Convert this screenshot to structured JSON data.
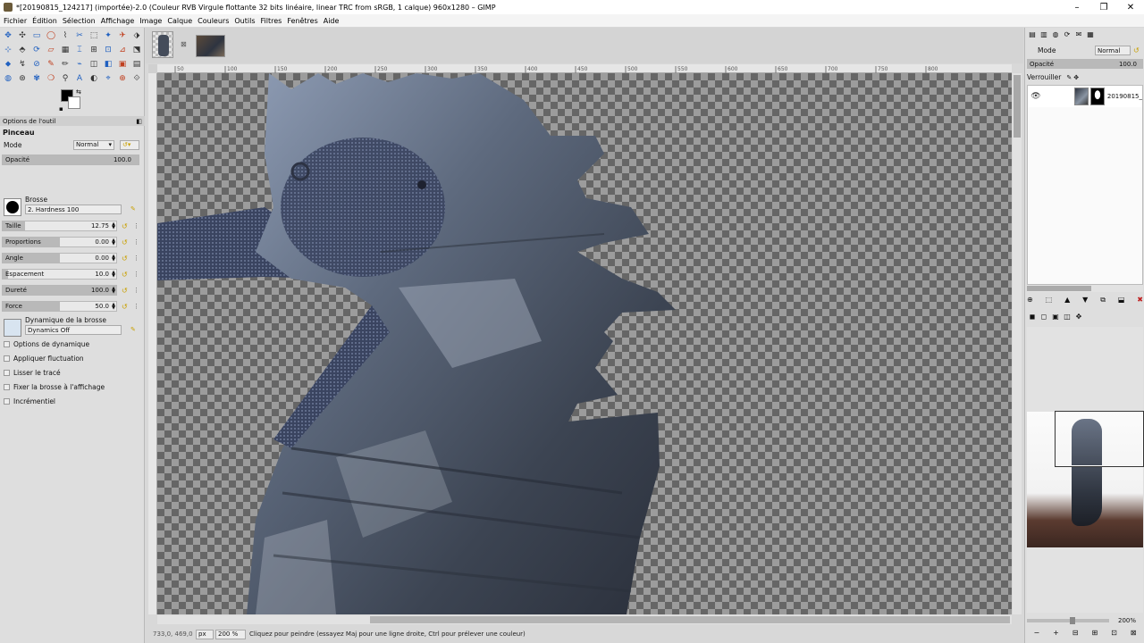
{
  "window": {
    "title": "*[20190815_124217] (importée)-2.0 (Couleur RVB Virgule flottante 32 bits linéaire, linear TRC from sRGB, 1 calque) 960x1280 – GIMP",
    "minimize": "–",
    "maximize": "❐",
    "close": "✕"
  },
  "menu": [
    "Fichier",
    "Édition",
    "Sélection",
    "Affichage",
    "Image",
    "Calque",
    "Couleurs",
    "Outils",
    "Filtres",
    "Fenêtres",
    "Aide"
  ],
  "toolbox": {
    "tools": [
      "✥",
      "✣",
      "▭",
      "◯",
      "⌇",
      "✂",
      "⬚",
      "✦",
      "✈",
      "⬗",
      "⊹",
      "⬘",
      "⟳",
      "▱",
      "▦",
      "⌶",
      "⊞",
      "⊡",
      "⊿",
      "⬔",
      "⬥",
      "↯",
      "⊘",
      "✎",
      "✏",
      "⌁",
      "◫",
      "◧",
      "▣",
      "▤",
      "◍",
      "⊛",
      "✾",
      "❍",
      "⚲",
      "A",
      "◐",
      "⌖",
      "⊕",
      "⟐"
    ],
    "colors_mini": "▪",
    "colors_swap": "⇆"
  },
  "tool_options": {
    "header": "Options de l'outil",
    "header_icon": "◧",
    "title": "Pinceau",
    "mode_label": "Mode",
    "mode_value": "Normal",
    "opacity_label": "Opacité",
    "opacity_value": "100.0",
    "opacity": 100,
    "brush_label": "Brosse",
    "brush_value": "2. Hardness 100",
    "sliders": [
      {
        "label": "Taille",
        "value": "12.75",
        "fraction": 0.2
      },
      {
        "label": "Proportions",
        "value": "0.00",
        "fraction": 0.5
      },
      {
        "label": "Angle",
        "value": "0.00",
        "fraction": 0.5
      },
      {
        "label": "Espacement",
        "value": "10.0",
        "fraction": 0.05
      },
      {
        "label": "Dureté",
        "value": "100.0",
        "fraction": 1.0
      },
      {
        "label": "Force",
        "value": "50.0",
        "fraction": 0.5
      }
    ],
    "dynamics_label": "Dynamique de la brosse",
    "dynamics_value": "Dynamics Off",
    "checks": [
      "Options de dynamique",
      "Appliquer fluctuation",
      "Lisser le tracé",
      "Fixer la brosse à l'affichage",
      "Incrémentiel"
    ]
  },
  "toolbox_footer": [
    "⛶",
    "⟲",
    "✖",
    "⊟"
  ],
  "canvas": {
    "ruler_labels": [
      "50",
      "100",
      "150",
      "200",
      "250",
      "300",
      "350",
      "400",
      "450",
      "500",
      "550",
      "600",
      "650",
      "700",
      "750",
      "800"
    ]
  },
  "statusbar": {
    "coords": "733,0, 469,0",
    "unit": "px",
    "zoom": "200 %",
    "message": "Cliquez pour peindre (essayez Maj pour une ligne droite, Ctrl pour prélever une couleur)"
  },
  "layers": {
    "mode_label": "Mode",
    "mode_value": "Normal",
    "opacity_label": "Opacité",
    "opacity_value": "100.0",
    "lock_label": "Verrouiller",
    "layer_name": "20190815_",
    "eye": "👁"
  },
  "dock_tabs": [
    "▤",
    "▥",
    "◍",
    "⟳",
    "✉",
    "▦"
  ],
  "layers_buttons": [
    "⊕",
    "⬚",
    "▲",
    "▼",
    "⧉",
    "⬓",
    "✖"
  ],
  "nav_tabs": [
    "◼",
    "◻",
    "▣",
    "◫",
    "✥"
  ],
  "nav_zoom": "200%",
  "nav_buttons": [
    "−",
    "+",
    "⊟",
    "⊞",
    "⊡",
    "⊠"
  ]
}
